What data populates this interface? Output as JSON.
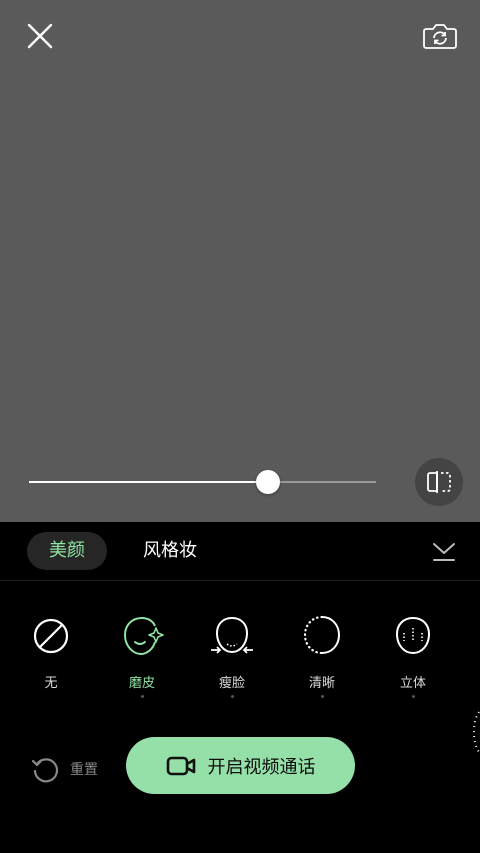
{
  "colors": {
    "accent": "#8fe3a4",
    "call_button": "#95e0a8",
    "preview_bg": "#5a5a5a",
    "panel_bg": "#000000"
  },
  "top_bar": {
    "close_icon": "close-icon",
    "camera_icon": "camera-switch-icon"
  },
  "slider": {
    "value_fraction": 0.69
  },
  "tabs": [
    {
      "label": "美颜",
      "active": true
    },
    {
      "label": "风格妆",
      "active": false
    }
  ],
  "options": [
    {
      "label": "无",
      "icon": "none-icon",
      "active": false
    },
    {
      "label": "磨皮",
      "icon": "smooth-skin-icon",
      "active": true
    },
    {
      "label": "瘦脸",
      "icon": "slim-face-icon",
      "active": false
    },
    {
      "label": "清晰",
      "icon": "clarity-icon",
      "active": false
    },
    {
      "label": "立体",
      "icon": "contour-icon",
      "active": false
    }
  ],
  "reset": {
    "label": "重置"
  },
  "call_button": {
    "label": "开启视频通话"
  }
}
